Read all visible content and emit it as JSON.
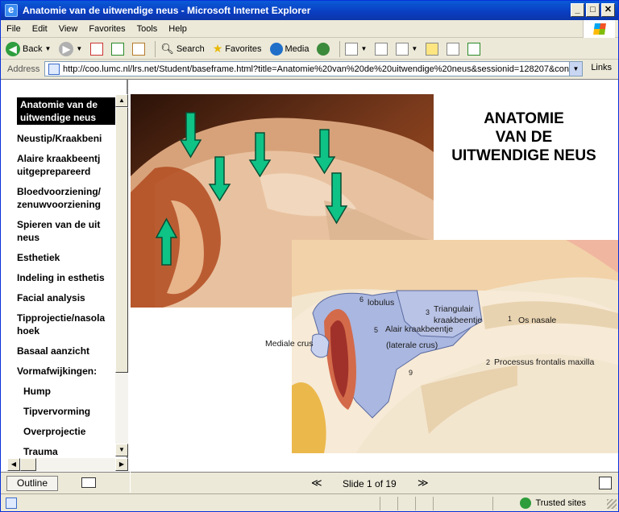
{
  "window": {
    "title": "Anatomie van de uitwendige neus - Microsoft Internet Explorer"
  },
  "menu": [
    "File",
    "Edit",
    "View",
    "Favorites",
    "Tools",
    "Help"
  ],
  "toolbar": {
    "back": "Back",
    "search": "Search",
    "favorites": "Favorites",
    "media": "Media"
  },
  "address": {
    "label": "Address",
    "url": "http://coo.lumc.nl/lrs.net/Student/baseframe.html?title=Anatomie%20van%20de%20uitwendige%20neus&sessionid=128207&con",
    "links": "Links"
  },
  "nav": {
    "items": [
      {
        "label": "Anatomie van de uitwendige neus",
        "line1": "Anatomie van de",
        "line2": "uitwendige neus",
        "selected": true
      },
      {
        "label": "Neustip/Kraakbeni",
        "line1": "Neustip/Kraakbeni"
      },
      {
        "label": "Alaire kraakbeentj uitgeprepareerd",
        "line1": "Alaire kraakbeentj",
        "line2": "uitgeprepareerd"
      },
      {
        "label": "Bloedvoorziening/ zenuwvoorziening",
        "line1": "Bloedvoorziening/",
        "line2": "zenuwvoorziening"
      },
      {
        "label": "Spieren van de uit neus",
        "line1": "Spieren van de uit",
        "line2": "neus"
      },
      {
        "label": "Esthetiek",
        "line1": "Esthetiek"
      },
      {
        "label": "Indeling in esthetis",
        "line1": "Indeling in esthetis"
      },
      {
        "label": "Facial analysis",
        "line1": "Facial analysis"
      },
      {
        "label": "Tipprojectie/nasola hoek",
        "line1": "Tipprojectie/nasola",
        "line2": "hoek"
      },
      {
        "label": "Basaal aanzicht",
        "line1": "Basaal aanzicht"
      },
      {
        "label": "Vormafwijkingen:",
        "line1": "Vormafwijkingen:"
      },
      {
        "label": "Hump",
        "line1": "Hump",
        "sub": true
      },
      {
        "label": "Tipvervorming",
        "line1": "Tipvervorming",
        "sub": true
      },
      {
        "label": "Overprojectie",
        "line1": "Overprojectie",
        "sub": true
      },
      {
        "label": "Trauma",
        "line1": "Trauma",
        "sub": true
      }
    ]
  },
  "outline_button": "Outline",
  "slide": {
    "title": "ANATOMIE\nVAN DE\nUITWENDIGE NEUS",
    "diagram_labels": {
      "n6": "6",
      "lobulus": "lobulus",
      "n3": "3",
      "triangulair": "Triangulair",
      "kraakbeentje": "kraakbeentje",
      "n1": "1",
      "os_nasale": "Os nasale",
      "n5": "5",
      "alair": "Alair kraakbeentje",
      "lateraal": "(laterale crus)",
      "mediale": "Mediale crus",
      "n9": "9",
      "n2": "2",
      "processus": "Processus frontalis maxilla"
    }
  },
  "slide_nav": {
    "counter": "Slide 1 of 19"
  },
  "status": {
    "zone": "Trusted sites"
  },
  "colors": {
    "arrow": "#0fc286",
    "title_bar": "#0a4fd0",
    "selected_nav": "#000000"
  }
}
